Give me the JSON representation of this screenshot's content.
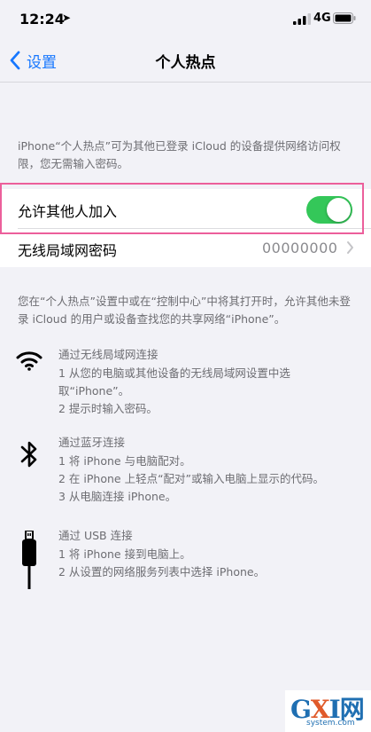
{
  "status_bar": {
    "time": "12:24",
    "network": "4G"
  },
  "nav": {
    "back_label": "设置",
    "title": "个人热点"
  },
  "intro_text": "iPhone“个人热点”可为其他已登录 iCloud 的设备提供网络访问权限，您无需输入密码。",
  "settings": {
    "allow_others_label": "允许其他人加入",
    "allow_others_enabled": true,
    "wifi_password_label": "无线局域网密码",
    "wifi_password_value": "00000000"
  },
  "info_text": "您在“个人热点”设置中或在“控制中心”中将其打开时，允许其他未登录 iCloud 的用户或设备查找您的共享网络“iPhone”。",
  "methods": [
    {
      "icon": "wifi-icon",
      "title": "通过无线局域网连接",
      "steps": [
        "1 从您的电脑或其他设备的无线局域网设置中选取“iPhone”。",
        "2 提示时输入密码。"
      ]
    },
    {
      "icon": "bluetooth-icon",
      "title": "通过蓝牙连接",
      "steps": [
        "1 将 iPhone 与电脑配对。",
        "2 在 iPhone 上轻点“配对”或输入电脑上显示的代码。",
        "3 从电脑连接 iPhone。"
      ]
    },
    {
      "icon": "usb-cable-icon",
      "title": "通过 USB 连接",
      "steps": [
        "1 将 iPhone 接到电脑上。",
        "2 从设置的网络服务列表中选择 iPhone。"
      ]
    }
  ],
  "watermark": {
    "logo_text": "GXI网",
    "domain": "system.com"
  },
  "colors": {
    "accent": "#1677ff",
    "toggle_on": "#34c759",
    "highlight": "#ec5f9b",
    "background": "#f2f2f7"
  }
}
